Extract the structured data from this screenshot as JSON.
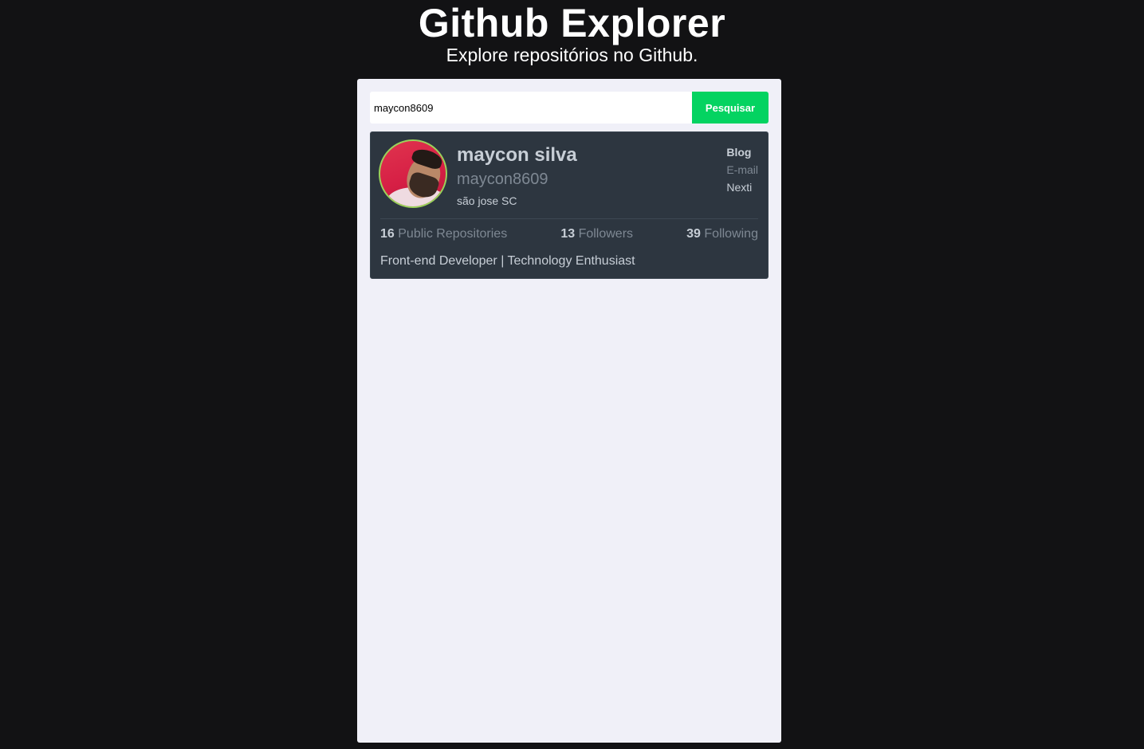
{
  "header": {
    "title": "Github Explorer",
    "subtitle": "Explore repositórios no Github."
  },
  "search": {
    "value": "maycon8609",
    "button_label": "Pesquisar"
  },
  "profile": {
    "name": "maycon silva",
    "login": "maycon8609",
    "location": "são jose SC",
    "links": {
      "blog": "Blog",
      "email": "E-mail",
      "company": "Nexti"
    },
    "stats": [
      {
        "count": "16",
        "label": "Public Repositories"
      },
      {
        "count": "13",
        "label": "Followers"
      },
      {
        "count": "39",
        "label": "Following"
      }
    ],
    "bio": "Front-end Developer | Technology Enthusiast"
  },
  "colors": {
    "background": "#121214",
    "panel": "#f0f0f8",
    "card": "#2d3640",
    "accent": "#04d361",
    "avatar_ring": "#9bd15a"
  }
}
